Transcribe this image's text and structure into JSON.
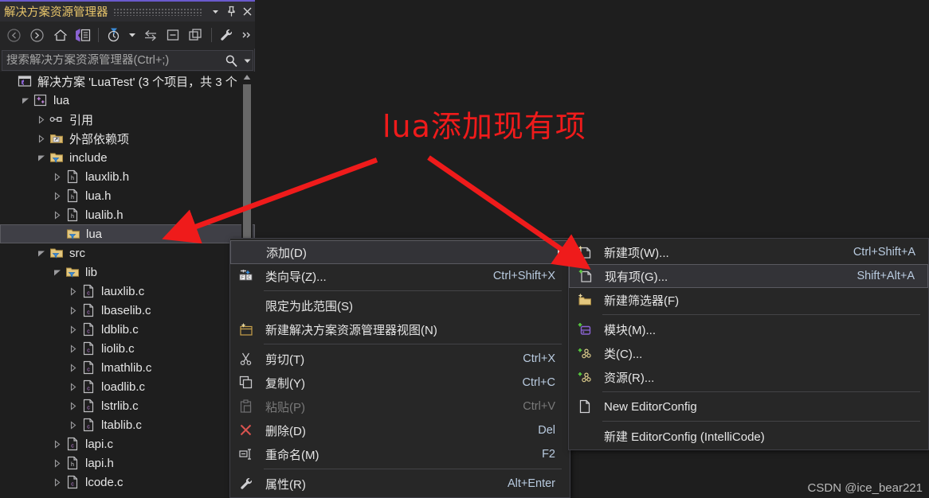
{
  "panel": {
    "title": "解决方案资源管理器",
    "titlebar_buttons": [
      {
        "name": "dropdown",
        "glyph": "▼"
      },
      {
        "name": "pin",
        "glyph": "pin-icon"
      },
      {
        "name": "close",
        "glyph": "✕"
      }
    ],
    "toolbar": [
      {
        "name": "back-icon",
        "label": "后退"
      },
      {
        "name": "forward-icon",
        "label": "前进"
      },
      {
        "name": "home-icon",
        "label": "主页"
      },
      {
        "name": "solution-view-icon",
        "label": "切换视图"
      },
      {
        "name": "pending-changes-filter-icon",
        "label": "筛选"
      },
      {
        "name": "sync-with-active-document-icon",
        "label": "与活动文档同步"
      },
      {
        "name": "collapse-all-icon",
        "label": "全部折叠"
      },
      {
        "name": "properties-window-icon",
        "label": "属性窗口"
      },
      {
        "name": "show-all-files-icon",
        "label": "显示所有文件"
      },
      {
        "name": "overflow-icon",
        "label": "更多"
      }
    ],
    "search": {
      "placeholder": "搜索解决方案资源管理器(Ctrl+;)",
      "value": ""
    }
  },
  "tree": {
    "items": [
      {
        "label": "解决方案 'LuaTest' (3 个项目，共 3 个",
        "depth": 0,
        "twisty": "none",
        "icon": "solution-icon",
        "selected": false
      },
      {
        "label": "lua",
        "depth": 1,
        "twisty": "expanded",
        "icon": "cpp-project-icon",
        "selected": false
      },
      {
        "label": "引用",
        "depth": 2,
        "twisty": "collapsed",
        "icon": "references-icon",
        "selected": false
      },
      {
        "label": "外部依赖项",
        "depth": 2,
        "twisty": "collapsed",
        "icon": "ext-deps-icon",
        "selected": false
      },
      {
        "label": "include",
        "depth": 2,
        "twisty": "expanded",
        "icon": "filter-icon",
        "selected": false
      },
      {
        "label": "lauxlib.h",
        "depth": 3,
        "twisty": "collapsed",
        "icon": "h-file-icon",
        "selected": false
      },
      {
        "label": "lua.h",
        "depth": 3,
        "twisty": "collapsed",
        "icon": "h-file-icon",
        "selected": false
      },
      {
        "label": "lualib.h",
        "depth": 3,
        "twisty": "collapsed",
        "icon": "h-file-icon",
        "selected": false
      },
      {
        "label": "lua",
        "depth": 3,
        "twisty": "none",
        "icon": "filter-icon",
        "selected": true
      },
      {
        "label": "src",
        "depth": 2,
        "twisty": "expanded",
        "icon": "filter-icon",
        "selected": false
      },
      {
        "label": "lib",
        "depth": 3,
        "twisty": "expanded",
        "icon": "filter-icon",
        "selected": false
      },
      {
        "label": "lauxlib.c",
        "depth": 4,
        "twisty": "collapsed",
        "icon": "c-file-icon",
        "selected": false
      },
      {
        "label": "lbaselib.c",
        "depth": 4,
        "twisty": "collapsed",
        "icon": "c-file-icon",
        "selected": false
      },
      {
        "label": "ldblib.c",
        "depth": 4,
        "twisty": "collapsed",
        "icon": "c-file-icon",
        "selected": false
      },
      {
        "label": "liolib.c",
        "depth": 4,
        "twisty": "collapsed",
        "icon": "c-file-icon",
        "selected": false
      },
      {
        "label": "lmathlib.c",
        "depth": 4,
        "twisty": "collapsed",
        "icon": "c-file-icon",
        "selected": false
      },
      {
        "label": "loadlib.c",
        "depth": 4,
        "twisty": "collapsed",
        "icon": "c-file-icon",
        "selected": false
      },
      {
        "label": "lstrlib.c",
        "depth": 4,
        "twisty": "collapsed",
        "icon": "c-file-icon",
        "selected": false
      },
      {
        "label": "ltablib.c",
        "depth": 4,
        "twisty": "collapsed",
        "icon": "c-file-icon",
        "selected": false
      },
      {
        "label": "lapi.c",
        "depth": 3,
        "twisty": "collapsed",
        "icon": "c-file-icon",
        "selected": false
      },
      {
        "label": "lapi.h",
        "depth": 3,
        "twisty": "collapsed",
        "icon": "h-file-icon",
        "selected": false
      },
      {
        "label": "lcode.c",
        "depth": 3,
        "twisty": "collapsed",
        "icon": "c-file-icon",
        "selected": false
      }
    ]
  },
  "context_menu": {
    "items": [
      {
        "label": "添加(D)",
        "shortcut": "",
        "icon": "none",
        "submenu": true,
        "highlight": true,
        "disabled": false,
        "sep_after": false
      },
      {
        "label": "类向导(Z)...",
        "shortcut": "Ctrl+Shift+X",
        "icon": "class-wizard-icon",
        "submenu": false,
        "highlight": false,
        "disabled": false,
        "sep_after": true
      },
      {
        "label": "限定为此范围(S)",
        "shortcut": "",
        "icon": "none",
        "submenu": false,
        "highlight": false,
        "disabled": false,
        "sep_after": false
      },
      {
        "label": "新建解决方案资源管理器视图(N)",
        "shortcut": "",
        "icon": "new-se-view-icon",
        "submenu": false,
        "highlight": false,
        "disabled": false,
        "sep_after": true
      },
      {
        "label": "剪切(T)",
        "shortcut": "Ctrl+X",
        "icon": "cut-icon",
        "submenu": false,
        "highlight": false,
        "disabled": false,
        "sep_after": false
      },
      {
        "label": "复制(Y)",
        "shortcut": "Ctrl+C",
        "icon": "copy-icon",
        "submenu": false,
        "highlight": false,
        "disabled": false,
        "sep_after": false
      },
      {
        "label": "粘贴(P)",
        "shortcut": "Ctrl+V",
        "icon": "paste-icon",
        "submenu": false,
        "highlight": false,
        "disabled": true,
        "sep_after": false
      },
      {
        "label": "删除(D)",
        "shortcut": "Del",
        "icon": "delete-icon",
        "submenu": false,
        "highlight": false,
        "disabled": false,
        "sep_after": false
      },
      {
        "label": "重命名(M)",
        "shortcut": "F2",
        "icon": "rename-icon",
        "submenu": false,
        "highlight": false,
        "disabled": false,
        "sep_after": true
      },
      {
        "label": "属性(R)",
        "shortcut": "Alt+Enter",
        "icon": "properties-icon",
        "submenu": false,
        "highlight": false,
        "disabled": false,
        "sep_after": false
      }
    ]
  },
  "submenu": {
    "items": [
      {
        "label": "新建项(W)...",
        "shortcut": "Ctrl+Shift+A",
        "icon": "new-item-icon",
        "highlight": false,
        "sep_after": false
      },
      {
        "label": "现有项(G)...",
        "shortcut": "Shift+Alt+A",
        "icon": "existing-item-icon",
        "highlight": true,
        "sep_after": false
      },
      {
        "label": "新建筛选器(F)",
        "shortcut": "",
        "icon": "new-filter-icon",
        "highlight": false,
        "sep_after": true
      },
      {
        "label": "模块(M)...",
        "shortcut": "",
        "icon": "module-icon",
        "highlight": false,
        "sep_after": false
      },
      {
        "label": "类(C)...",
        "shortcut": "",
        "icon": "class-icon",
        "highlight": false,
        "sep_after": false
      },
      {
        "label": "资源(R)...",
        "shortcut": "",
        "icon": "resource-icon",
        "highlight": false,
        "sep_after": true
      },
      {
        "label": "New EditorConfig",
        "shortcut": "",
        "icon": "editorconfig-icon",
        "highlight": false,
        "sep_after": true
      },
      {
        "label": "新建 EditorConfig (IntelliCode)",
        "shortcut": "",
        "icon": "none",
        "highlight": false,
        "sep_after": false
      }
    ]
  },
  "annotation": {
    "text": "lua添加现有项",
    "color": "#ef1b1b"
  },
  "watermark": {
    "text": "CSDN @ice_bear221"
  },
  "colors": {
    "accent_purple": "#6a5acd",
    "title_text": "#e8c56a",
    "panel_bg": "#252526",
    "tree_bg": "#1e1e1e",
    "menu_bg": "#272727",
    "shortcut_text": "#b9cbe0",
    "annotation_red": "#ef1b1b"
  }
}
